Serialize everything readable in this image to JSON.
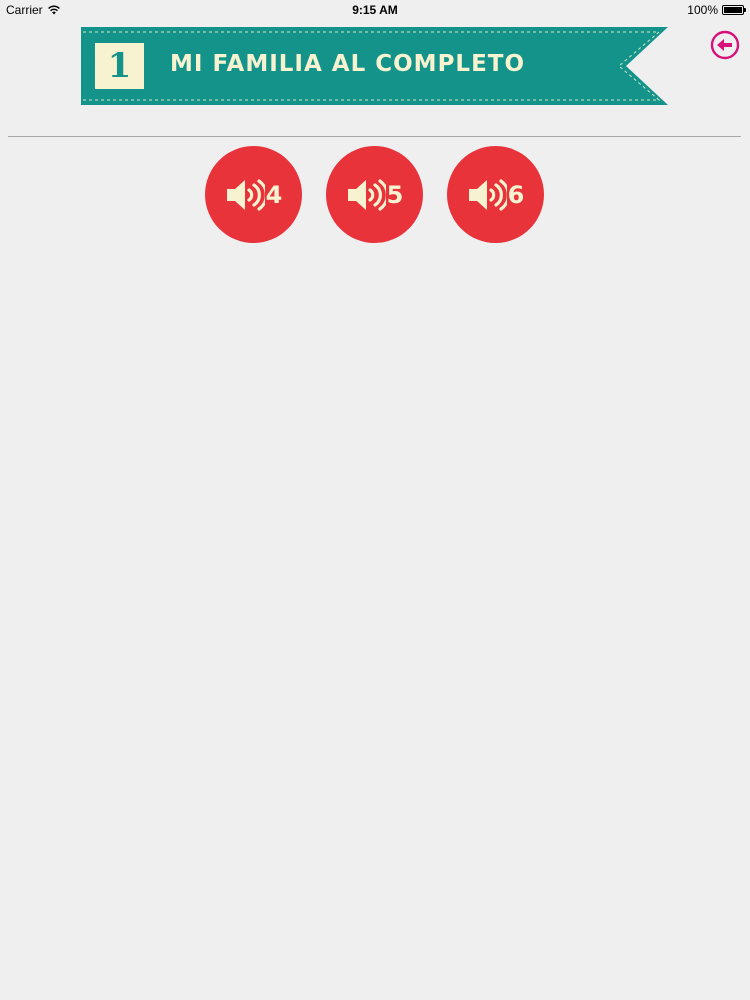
{
  "status_bar": {
    "carrier": "Carrier",
    "time": "9:15 AM",
    "battery": "100%"
  },
  "banner": {
    "number": "1",
    "title": "MI FAMILIA AL COMPLETO"
  },
  "colors": {
    "background": "#efeff0",
    "banner_teal": "#13938a",
    "banner_cream": "#f7f2cf",
    "audio_red": "#e8333b",
    "back_magenta": "#d6127a"
  },
  "audio_buttons": [
    {
      "label": "4",
      "icon": "speaker-icon"
    },
    {
      "label": "5",
      "icon": "speaker-icon"
    },
    {
      "label": "6",
      "icon": "speaker-icon"
    }
  ],
  "back_button": {
    "icon": "arrow-left-circle-icon"
  }
}
